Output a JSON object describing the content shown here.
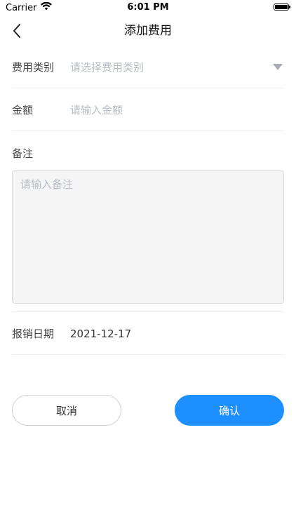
{
  "status_bar": {
    "carrier": "Carrier",
    "time": "6:01 PM",
    "wifi_icon": "wifi-icon",
    "battery_icon": "battery-icon"
  },
  "nav": {
    "title": "添加费用",
    "back_icon": "chevron-left-icon"
  },
  "form": {
    "category": {
      "label": "费用类别",
      "placeholder": "请选择费用类别",
      "icon": "triangle-down-icon"
    },
    "amount": {
      "label": "金额",
      "placeholder": "请输入金额",
      "value": ""
    },
    "remark": {
      "label": "备注",
      "placeholder": "请输入备注",
      "value": ""
    },
    "date": {
      "label": "报销日期",
      "value": "2021-12-17"
    }
  },
  "actions": {
    "cancel_label": "取消",
    "confirm_label": "确认"
  },
  "colors": {
    "primary": "#1e8fff",
    "placeholder": "#b8bcc4",
    "divider": "#eeeeee",
    "textarea_bg": "#f5f5f5"
  }
}
